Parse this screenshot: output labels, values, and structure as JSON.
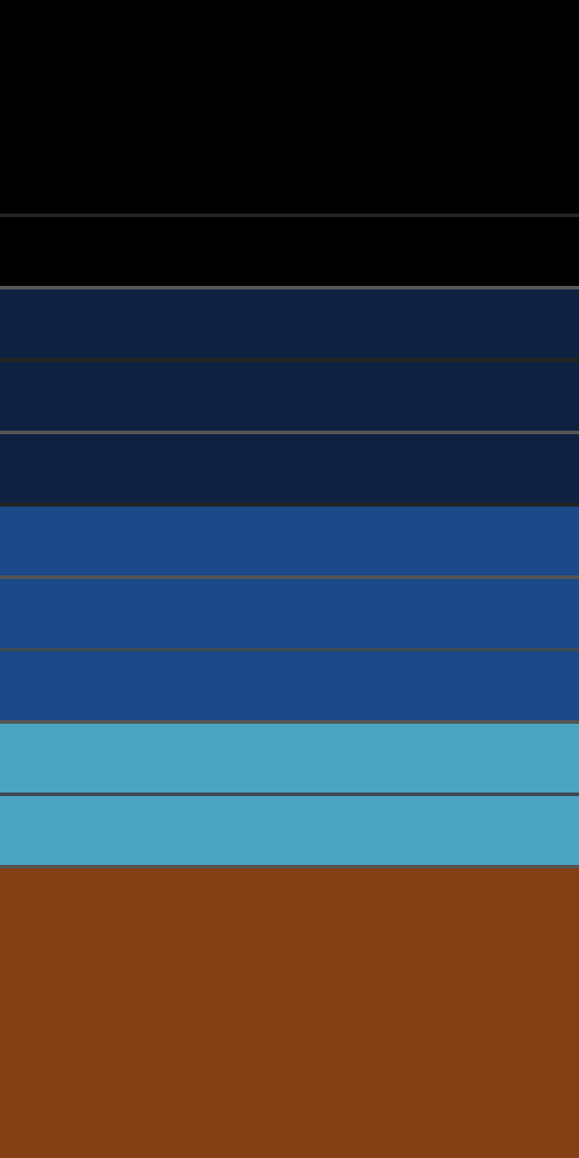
{
  "colors": {
    "top": "#000000",
    "navy": "#0e2141",
    "blue": "#1b4989",
    "sky": "#4ba5c2",
    "brown": "#843f14",
    "divider_dark": "#232323",
    "divider_mid": "#555555",
    "divider_slate": "#3e4a56"
  },
  "bands": [
    {
      "color_key": "top"
    },
    {
      "color_key": "top"
    },
    {
      "color_key": "navy"
    },
    {
      "color_key": "navy"
    },
    {
      "color_key": "navy"
    },
    {
      "color_key": "blue"
    },
    {
      "color_key": "blue"
    },
    {
      "color_key": "blue"
    },
    {
      "color_key": "sky"
    },
    {
      "color_key": "sky"
    },
    {
      "color_key": "brown"
    }
  ]
}
